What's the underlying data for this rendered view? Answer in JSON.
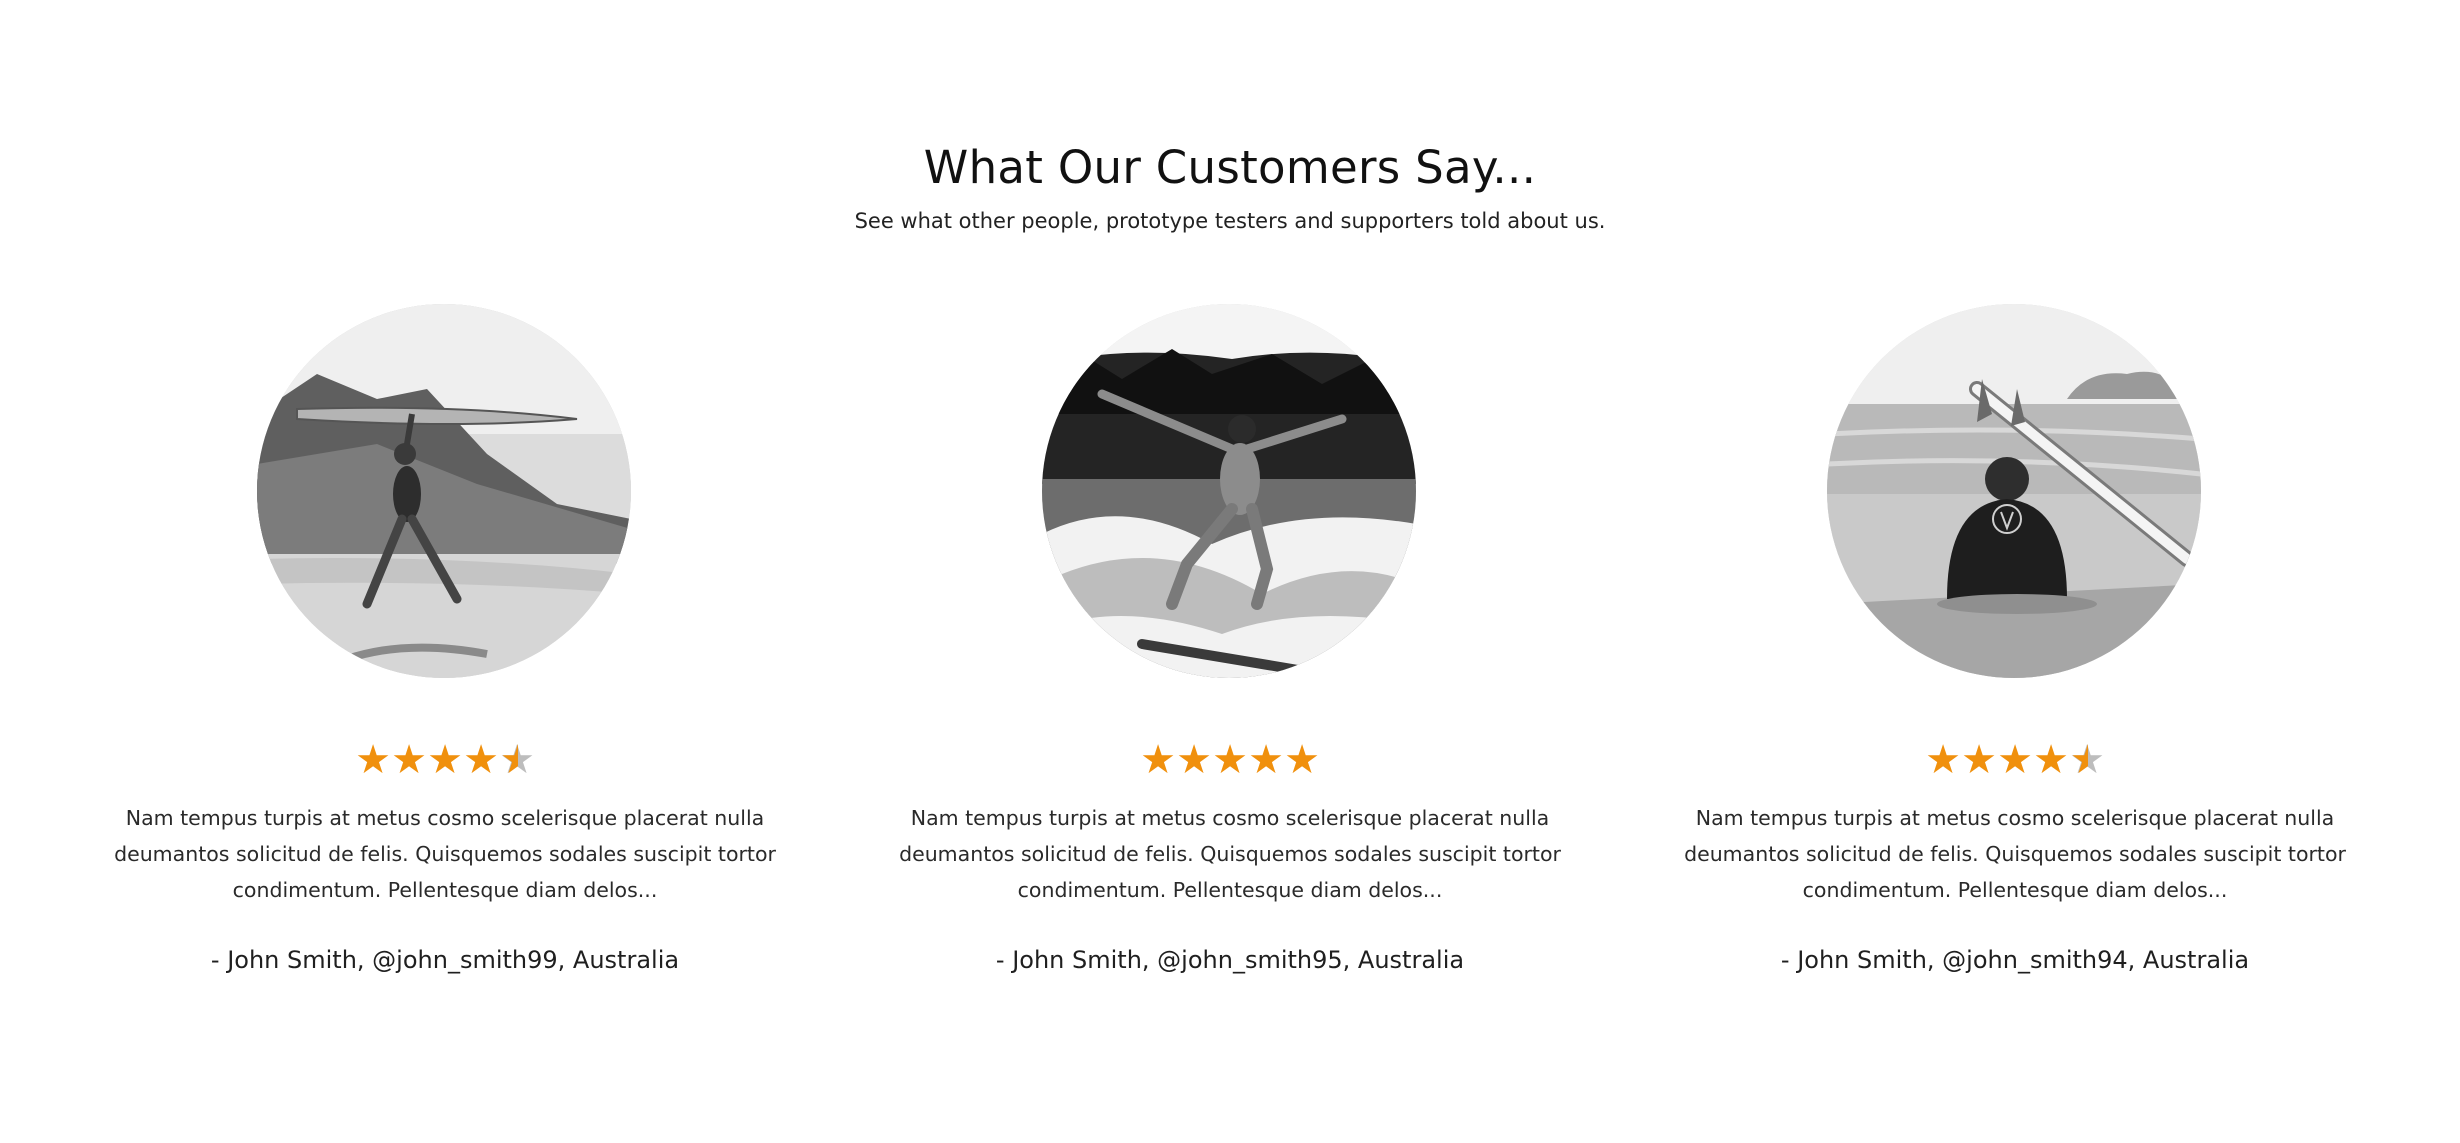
{
  "section": {
    "title": "What Our Customers Say...",
    "subtitle": "See what other people, prototype testers and supporters told about us."
  },
  "colors": {
    "star_filled": "#f0900d",
    "star_empty": "#bdbdbd",
    "text": "#1a1a1a",
    "background": "#ffffff"
  },
  "testimonials": [
    {
      "image": "surfer-jumping-with-board-photo",
      "rating": 4.5,
      "quote": "Nam tempus turpis at metus cosmo scelerisque placerat nulla deumantos solicitud de felis. Quisquemos sodales suscipit tortor condimentum. Pellentesque diam delos...",
      "author": "- John Smith, @john_smith99, Australia"
    },
    {
      "image": "woman-surfing-wave-photo",
      "rating": 5,
      "quote": "Nam tempus turpis at metus cosmo scelerisque placerat nulla deumantos solicitud de felis. Quisquemos sodales suscipit tortor condimentum. Pellentesque diam delos...",
      "author": "- John Smith, @john_smith95, Australia"
    },
    {
      "image": "man-sitting-on-beach-with-surfboard-photo",
      "rating": 4.5,
      "quote": "Nam tempus turpis at metus cosmo scelerisque placerat nulla deumantos solicitud de felis. Quisquemos sodales suscipit tortor condimentum. Pellentesque diam delos...",
      "author": "- John Smith, @john_smith94, Australia"
    }
  ]
}
